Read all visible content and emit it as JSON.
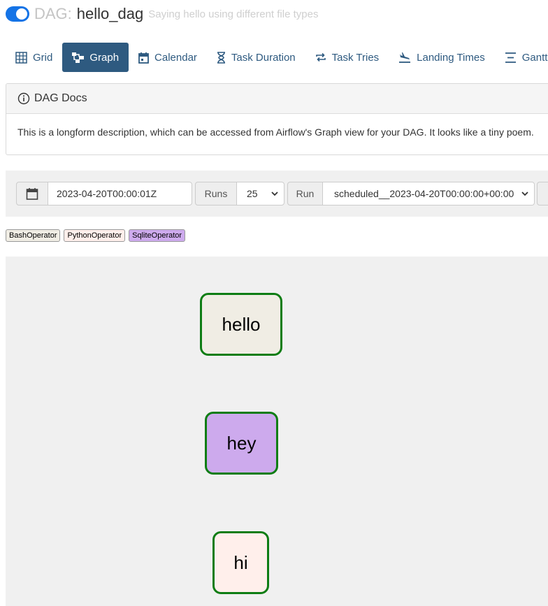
{
  "header": {
    "dag_prefix": "DAG:",
    "dag_id": "hello_dag",
    "description": "Saying hello using different file types",
    "paused": false
  },
  "tabs": [
    {
      "label": "Grid",
      "icon": "grid-icon",
      "active": false
    },
    {
      "label": "Graph",
      "icon": "graph-icon",
      "active": true
    },
    {
      "label": "Calendar",
      "icon": "calendar-icon",
      "active": false
    },
    {
      "label": "Task Duration",
      "icon": "hourglass-icon",
      "active": false
    },
    {
      "label": "Task Tries",
      "icon": "retry-icon",
      "active": false
    },
    {
      "label": "Landing Times",
      "icon": "plane-landing-icon",
      "active": false
    },
    {
      "label": "Gantt",
      "icon": "gantt-icon",
      "active": false
    }
  ],
  "docs": {
    "title": "DAG Docs",
    "body": "This is a longform description, which can be accessed from Airflow's Graph view for your DAG. It looks like a tiny poem."
  },
  "controls": {
    "base_date": "2023-04-20T00:00:01Z",
    "runs_label": "Runs",
    "runs_value": "25",
    "run_label": "Run",
    "run_value": "scheduled__2023-04-20T00:00:00+00:00"
  },
  "legend": [
    {
      "label": "BashOperator",
      "color": "#f0ede4"
    },
    {
      "label": "PythonOperator",
      "color": "#ffefeb"
    },
    {
      "label": "SqliteOperator",
      "color": "#cdaaed"
    }
  ],
  "graph": {
    "nodes": [
      {
        "label": "hello",
        "operator": "BashOperator",
        "fill": "#f0ede4",
        "status_color": "#0e7d14"
      },
      {
        "label": "hey",
        "operator": "SqliteOperator",
        "fill": "#cdaaed",
        "status_color": "#0e7d14"
      },
      {
        "label": "hi",
        "operator": "PythonOperator",
        "fill": "#ffefeb",
        "status_color": "#0e7d14"
      }
    ]
  },
  "colors": {
    "accent": "#2e5a80",
    "toggle": "#1473e6",
    "success_border": "#0e7d14"
  }
}
